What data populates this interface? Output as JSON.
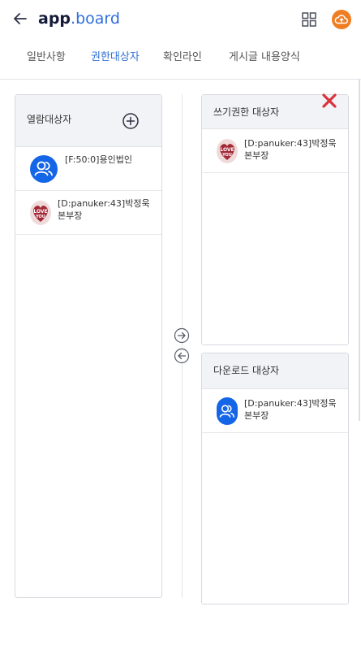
{
  "header": {
    "brand_bold": "app",
    "brand_rest": ".board",
    "back_icon": "arrow-left-icon",
    "grid_icon": "grid-icon",
    "cloud_icon": "cloud-upload-icon",
    "accent_color": "#ef7d22"
  },
  "tabs": [
    {
      "label": "일반사항",
      "active": false
    },
    {
      "label": "권한대상자",
      "active": true
    },
    {
      "label": "확인라인",
      "active": false
    },
    {
      "label": "게시글 내용양식",
      "active": false
    }
  ],
  "read_panel": {
    "title": "열람대상자",
    "add_icon": "plus-circle-icon",
    "items": [
      {
        "name": "[F:50:0]용인법인",
        "icon": "group-user-icon"
      },
      {
        "name": "[D:panuker:43]박정욱본부장",
        "icon": "love-you-avatar"
      }
    ]
  },
  "write_panel": {
    "title": "쓰기권한 대상자",
    "close_icon": "close-x-icon",
    "items": [
      {
        "name": "[D:panuker:43]박정욱본부장",
        "icon": "love-you-avatar"
      }
    ]
  },
  "download_panel": {
    "title": "다운로드 대상자",
    "items": [
      {
        "name": "[D:panuker:43]박정욱본부장",
        "icon": "group-user-icon"
      }
    ]
  },
  "move_buttons": {
    "right_icon": "arrow-right-circle-icon",
    "left_icon": "arrow-left-circle-icon"
  },
  "colors": {
    "brand_dark": "#151b3a",
    "brand_blue": "#2f6fdb",
    "active_tab": "#2d6fd8",
    "user_icon": "#1565e8",
    "close": "#d9343c"
  }
}
